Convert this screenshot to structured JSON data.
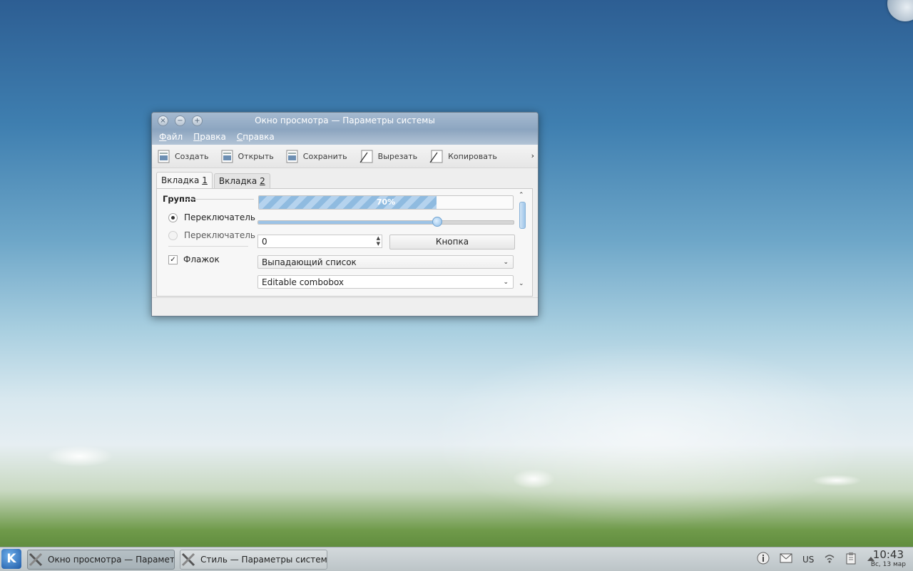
{
  "window": {
    "title": "Окно просмотра — Параметры системы",
    "controls": {
      "close": "×",
      "minimize": "−",
      "maximize": "+"
    }
  },
  "menu": [
    {
      "label": "Файл",
      "mnemonic": "Ф",
      "rest": "айл"
    },
    {
      "label": "Правка",
      "mnemonic": "П",
      "rest": "равка"
    },
    {
      "label": "Справка",
      "mnemonic": "С",
      "rest": "правка"
    }
  ],
  "toolbar": {
    "items": [
      {
        "label": "Создать",
        "icon": "document-new-icon"
      },
      {
        "label": "Открыть",
        "icon": "document-open-icon"
      },
      {
        "label": "Сохранить",
        "icon": "document-save-icon"
      },
      {
        "label": "Вырезать",
        "icon": "edit-cut-icon"
      },
      {
        "label": "Копировать",
        "icon": "edit-copy-icon"
      }
    ],
    "more": "›"
  },
  "tabs": [
    {
      "prefix": "Вкладка ",
      "mnemonic": "1",
      "active": true
    },
    {
      "prefix": "Вкладка ",
      "mnemonic": "2",
      "active": false
    }
  ],
  "group": {
    "title": "Группа",
    "radio1": "Переключатель",
    "radio2": "Переключатель",
    "checkbox": "Флажок",
    "check_mark": "✓"
  },
  "progress": {
    "value": 0.7,
    "text": "70%"
  },
  "slider": {
    "value": 0.7
  },
  "spinbox": {
    "value": "0"
  },
  "button": {
    "label": "Кнопка"
  },
  "combo": {
    "selected": "Выпадающий список",
    "arrow": "⌄"
  },
  "editable_combo": {
    "value": "Editable combobox",
    "arrow": "⌄"
  },
  "taskbar": {
    "tasks": [
      {
        "label": "Окно просмотра — Параметры системы",
        "active": true
      },
      {
        "label": "Стиль — Параметры системы",
        "active": false
      }
    ],
    "keyboard_layout": "US",
    "time": "10:43",
    "date": "Вс, 13 мар",
    "kde_logo": "K"
  }
}
